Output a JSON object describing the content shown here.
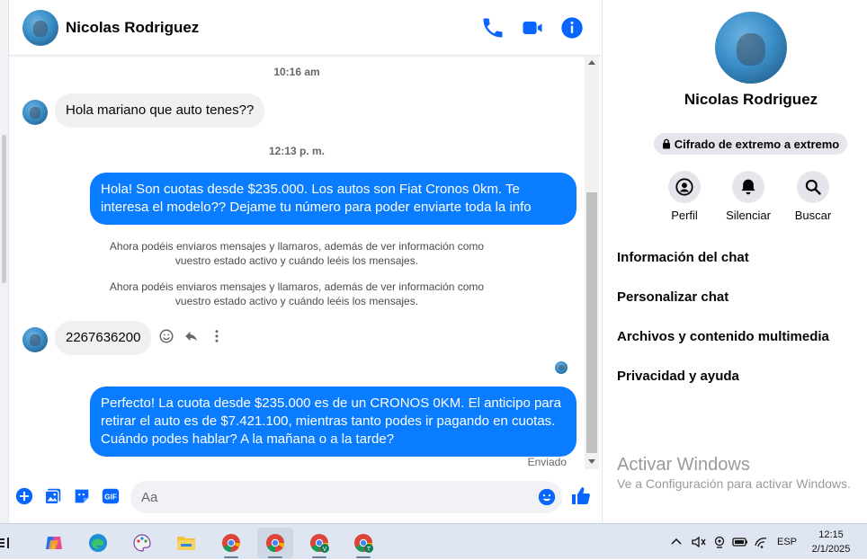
{
  "contact": {
    "name": "Nicolas Rodriguez"
  },
  "messages": {
    "time_1": "10:16 am",
    "in_1": "Hola mariano que auto tenes??",
    "time_2": "12:13 p. m.",
    "out_1": "Hola! Son cuotas desde $235.000. Los autos son Fiat Cronos 0km. Te interesa el modelo?? Dejame tu número para poder enviarte toda la info",
    "sys_1": "Ahora podéis enviaros mensajes y llamaros, además de ver información como vuestro estado activo y cuándo leéis los mensajes.",
    "sys_2": "Ahora podéis enviaros mensajes y llamaros, además de ver información como vuestro estado activo y cuándo leéis los mensajes.",
    "in_2": "2267636200",
    "out_2": "Perfecto! La cuota desde $235.000 es de un CRONOS 0KM. El anticipo para retirar el auto es de $7.421.100, mientras tanto podes ir pagando en cuotas. Cuándo podes hablar? A la mañana o a la tarde?",
    "status": "Enviado"
  },
  "composer": {
    "placeholder": "Aa"
  },
  "panel": {
    "encryption": "Cifrado de extremo a extremo",
    "buttons": [
      {
        "label": "Perfil",
        "icon": "profile-icon"
      },
      {
        "label": "Silenciar",
        "icon": "bell-icon"
      },
      {
        "label": "Buscar",
        "icon": "search-icon"
      }
    ],
    "items": [
      "Información del chat",
      "Personalizar chat",
      "Archivos y contenido multimedia",
      "Privacidad y ayuda"
    ],
    "watermark_title": "Activar Windows",
    "watermark_sub": "Ve a Configuración para activar Windows."
  },
  "taskbar": {
    "language": "ESP",
    "time": "12:15",
    "date": "2/1/2025",
    "chrome_badges": [
      "V",
      "T"
    ]
  },
  "colors": {
    "accent": "#0a7cff",
    "icon_blue": "#0866ff"
  }
}
